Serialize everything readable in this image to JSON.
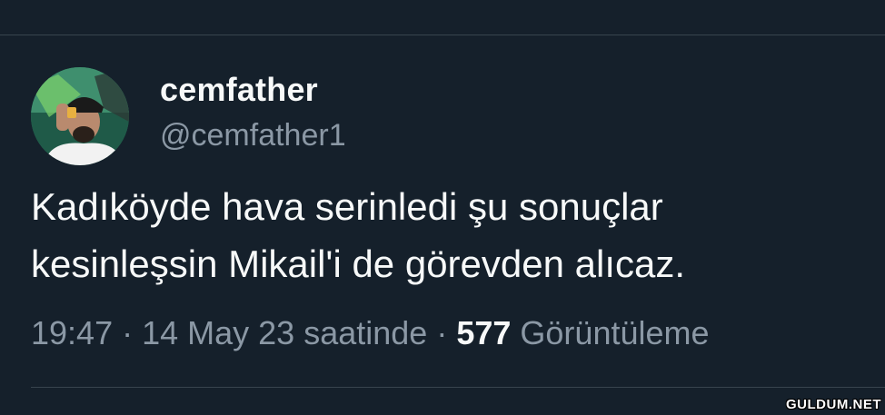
{
  "tweet": {
    "display_name": "cemfather",
    "handle": "@cemfather1",
    "text": "Kadıköyde hava serinledi şu sonuçlar\nkesinleşsin Mikail'i de görevden alıcaz.",
    "time": "19:47",
    "separator": " · ",
    "date": "14 May 23 saatinde",
    "views_count": "577",
    "views_label": "Görüntüleme"
  },
  "watermark": "GULDUM.NET",
  "colors": {
    "background": "#15202b",
    "primary_text": "#f7f9f9",
    "secondary_text": "#8b98a5",
    "divider": "#38444d"
  }
}
